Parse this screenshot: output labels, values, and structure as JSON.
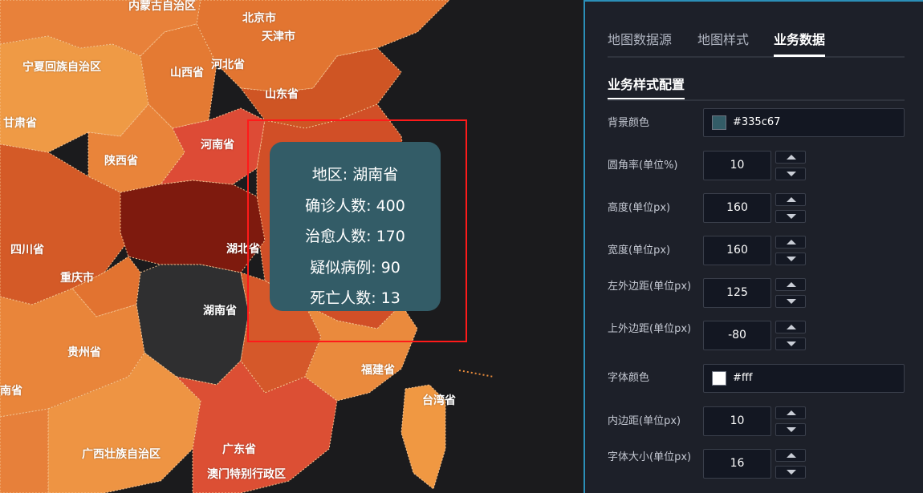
{
  "colors": {
    "tooltip_bg": "#335c67",
    "selection_border": "#ff1a1a",
    "panel_bg": "#1d2029"
  },
  "map": {
    "labels": {
      "neimenggu": "内蒙古自治区",
      "beijing": "北京市",
      "tianjin": "天津市",
      "ningxia": "宁夏回族自治区",
      "shanxi": "山西省",
      "hebei": "河北省",
      "shandong": "山东省",
      "gansu": "甘肃省",
      "henan": "河南省",
      "shaanxi": "陕西省",
      "sichuan": "四川省",
      "hubei": "湖北省",
      "chongqing": "重庆市",
      "hunan": "湖南省",
      "guizhou": "贵州省",
      "fujian": "福建省",
      "taiwan": "台湾省",
      "yunnan": "南省",
      "guangdong": "广东省",
      "guangxi": "广西壮族自治区",
      "macau_hk": "澳门特别行政区"
    }
  },
  "tooltip": {
    "region": "地区: 湖南省",
    "confirmed": "确诊人数: 400",
    "cured": "治愈人数: 170",
    "suspected": "疑似病例: 90",
    "deaths": "死亡人数: 13"
  },
  "panel": {
    "tabs": [
      "地图数据源",
      "地图样式",
      "业务数据"
    ],
    "section_title": "业务样式配置",
    "fields": {
      "background_color": {
        "label": "背景颜色",
        "value": "#335c67",
        "swatch": "#335c67"
      },
      "border_radius": {
        "label": "圆角率(单位%)",
        "value": "10"
      },
      "height": {
        "label": "高度(单位px)",
        "value": "160"
      },
      "width": {
        "label": "宽度(单位px)",
        "value": "160"
      },
      "margin_left": {
        "label": "左外边距(单位px)",
        "value": "125"
      },
      "margin_top": {
        "label": "上外边距(单位px)",
        "value": "-80"
      },
      "font_color": {
        "label": "字体颜色",
        "value": "#fff",
        "swatch": "#ffffff"
      },
      "padding": {
        "label": "内边距(单位px)",
        "value": "10"
      },
      "font_size": {
        "label": "字体大小(单位px)",
        "value": "16"
      }
    }
  }
}
